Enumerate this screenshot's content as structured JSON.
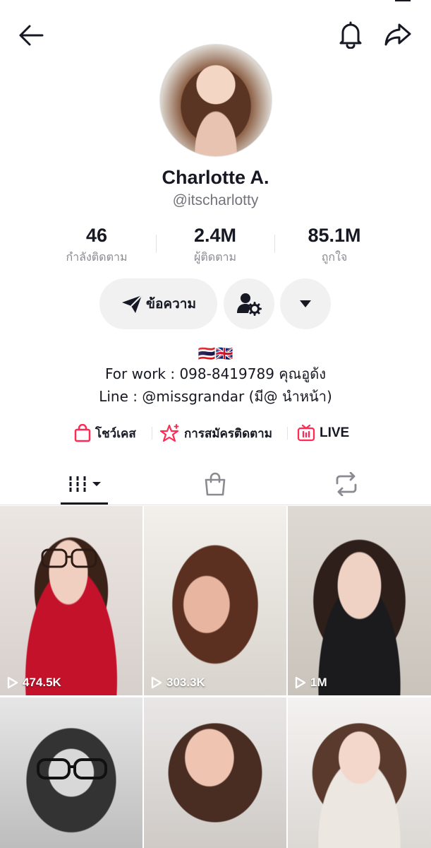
{
  "profile": {
    "name": "Charlotte A.",
    "handle": "@itscharlotty"
  },
  "stats": [
    {
      "value": "46",
      "label": "กำลังติดตาม"
    },
    {
      "value": "2.4M",
      "label": "ผู้ติดตาม"
    },
    {
      "value": "85.1M",
      "label": "ถูกใจ"
    }
  ],
  "actions": {
    "message_label": "ข้อความ"
  },
  "bio": {
    "flags": "🇹🇭🇬🇧",
    "line1": "For work : 098-8419789 คุณอูด้ง",
    "line2": "Line : @missgrandar (มี@ นำหน้า)"
  },
  "links": {
    "showcase": "โชว์เคส",
    "subscription": "การสมัครติดตาม",
    "live": "LIVE"
  },
  "videos": [
    {
      "views": "474.5K"
    },
    {
      "views": "303.3K"
    },
    {
      "views": "1M"
    },
    {
      "views": ""
    },
    {
      "views": ""
    },
    {
      "views": ""
    }
  ],
  "colors": {
    "text": "#161823",
    "secondary": "#73747b",
    "accent": "#fe2c55",
    "button_bg": "#f1f1f2"
  },
  "icons": {
    "back": "arrow-left",
    "notifications": "bell",
    "share": "share-arrow",
    "add_friend": "person-gear",
    "more": "triangle-down",
    "showcase": "shopping-bag",
    "subscription": "star-sparkle",
    "live": "tv"
  }
}
